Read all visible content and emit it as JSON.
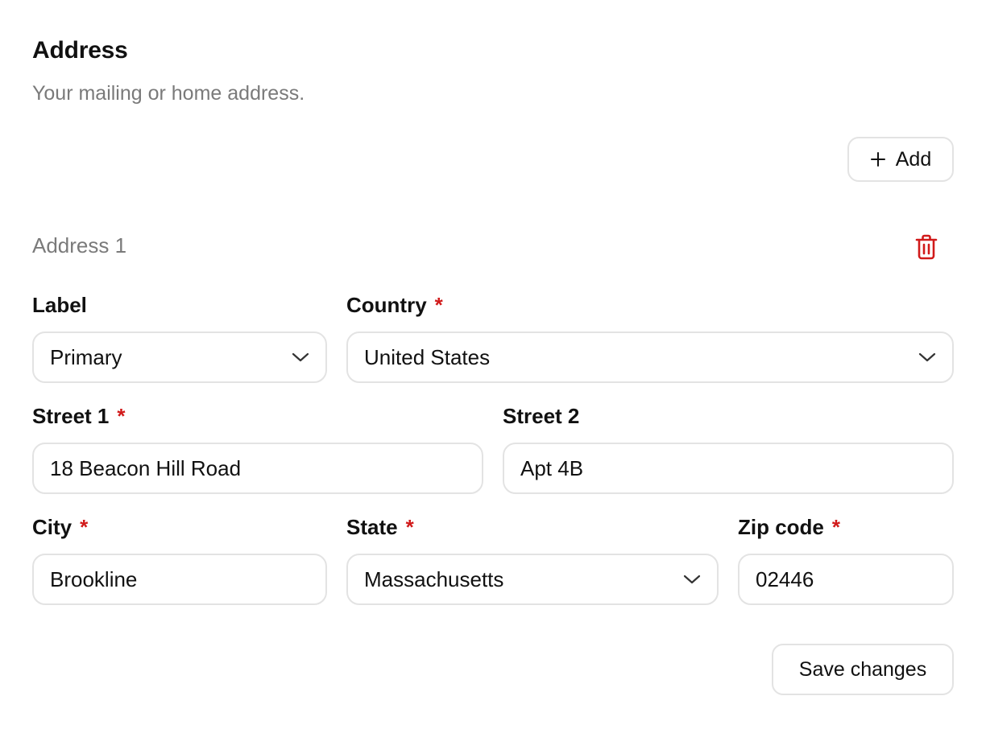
{
  "section": {
    "title": "Address",
    "subtitle": "Your mailing or home address."
  },
  "add_button": {
    "label": "Add",
    "icon": "plus-icon"
  },
  "address": {
    "title": "Address 1",
    "delete_icon": "trash-icon",
    "delete_color": "#d11a1a",
    "fields": {
      "label": {
        "label": "Label",
        "value": "Primary"
      },
      "country": {
        "label": "Country",
        "required_mark": "*",
        "value": "United States"
      },
      "street1": {
        "label": "Street 1",
        "required_mark": "*",
        "value": "18 Beacon Hill Road"
      },
      "street2": {
        "label": "Street 2",
        "value": "Apt 4B"
      },
      "city": {
        "label": "City",
        "required_mark": "*",
        "value": "Brookline"
      },
      "state": {
        "label": "State",
        "required_mark": "*",
        "value": "Massachusetts"
      },
      "zip": {
        "label": "Zip code",
        "required_mark": "*",
        "value": "02446"
      }
    }
  },
  "save_button": {
    "label": "Save changes"
  },
  "colors": {
    "required": "#d11a1a",
    "muted_text": "#7a7a7a",
    "border": "#e3e3e3"
  }
}
